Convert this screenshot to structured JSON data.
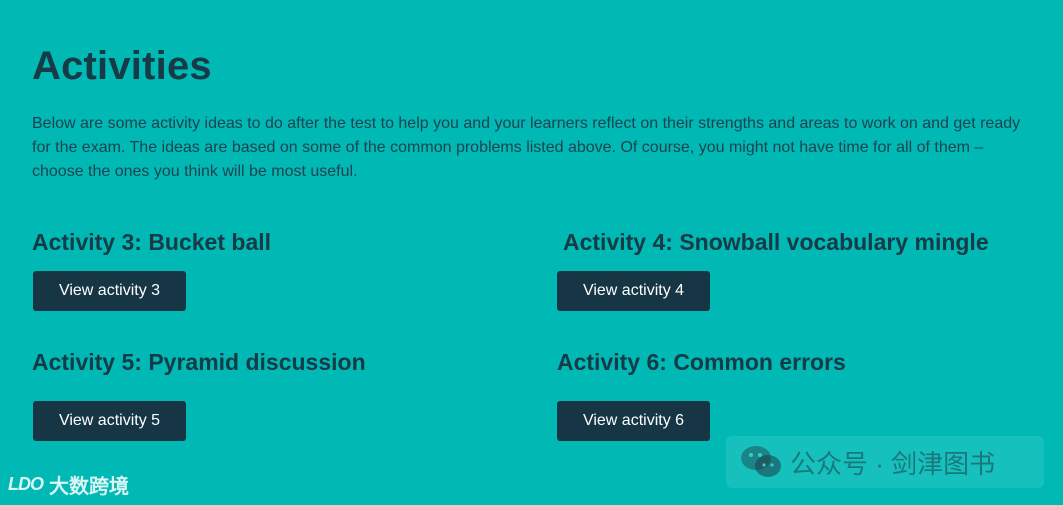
{
  "page": {
    "title": "Activities",
    "intro": "Below are some activity ideas to do after the test to help you and your learners reflect on their strengths and areas to work on and get ready for the exam. The ideas are based on some of the common problems listed above. Of course, you might not have time for all of them – choose the ones you think will be most useful."
  },
  "activities": [
    {
      "heading": "Activity 3: Bucket ball",
      "button": "View activity 3"
    },
    {
      "heading": "Activity 4: Snowball vocabulary mingle",
      "button": "View activity 4"
    },
    {
      "heading": "Activity 5: Pyramid discussion",
      "button": "View activity 5"
    },
    {
      "heading": "Activity 6: Common errors",
      "button": "View activity 6"
    }
  ],
  "watermarks": {
    "left_logo": "LDO",
    "left_text": "大数跨境",
    "right_text": "公众号 · 剑津图书",
    "right_icon": "wechat-icon"
  },
  "colors": {
    "background": "#00b8b4",
    "text": "#163a46",
    "button": "#163645",
    "button_text": "#ffffff"
  }
}
